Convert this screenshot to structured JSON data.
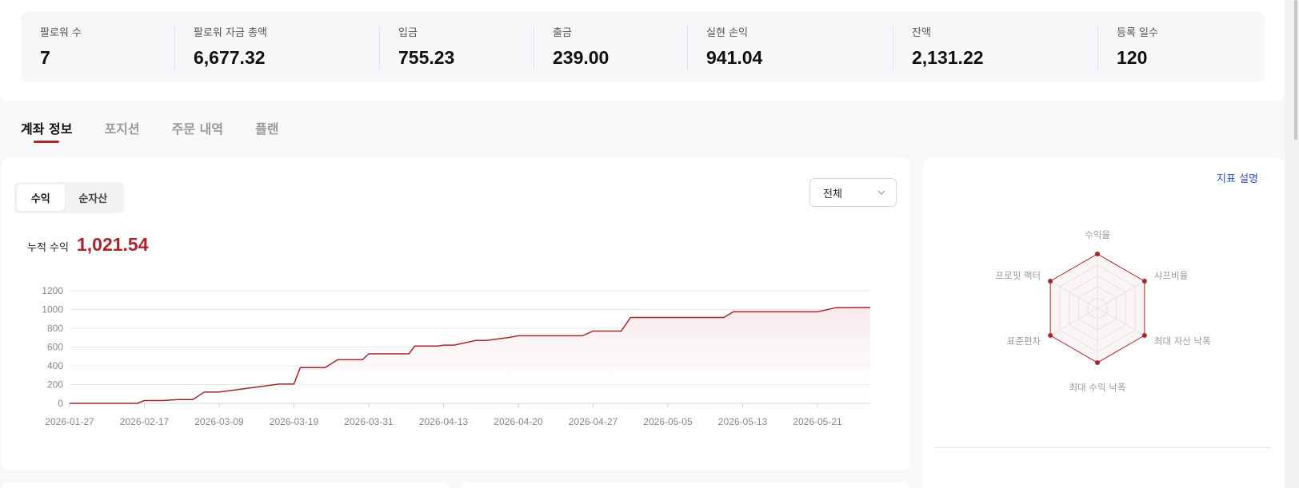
{
  "stats": [
    {
      "label": "팔로워 수",
      "value": "7"
    },
    {
      "label": "팔로워 자금 총액",
      "value": "6,677.32"
    },
    {
      "label": "입금",
      "value": "755.23"
    },
    {
      "label": "출금",
      "value": "239.00"
    },
    {
      "label": "실현 손익",
      "value": "941.04"
    },
    {
      "label": "잔액",
      "value": "2,131.22"
    },
    {
      "label": "등록 일수",
      "value": "120"
    }
  ],
  "tabs": [
    {
      "label": "계좌 정보",
      "active": true
    },
    {
      "label": "포지션",
      "active": false
    },
    {
      "label": "주문 내역",
      "active": false
    },
    {
      "label": "플랜",
      "active": false
    }
  ],
  "toggle": {
    "profit": "수익",
    "net_asset": "순자산"
  },
  "period_select": {
    "value": "전체"
  },
  "cumulative": {
    "label": "누적 수익",
    "value": "1,021.54"
  },
  "colors": {
    "accent": "#a8252f",
    "link": "#2f55c8",
    "fill": "#f7e9eb"
  },
  "chart_data": {
    "type": "area",
    "title": "",
    "xlabel": "",
    "ylabel": "",
    "ylim": [
      0,
      1200
    ],
    "yticks": [
      0,
      200,
      400,
      600,
      800,
      1000,
      1200
    ],
    "xtick_labels": [
      "2026-01-27",
      "2026-02-17",
      "2026-03-09",
      "2026-03-19",
      "2026-03-31",
      "2026-04-13",
      "2026-04-20",
      "2026-04-27",
      "2026-05-05",
      "2026-05-13",
      "2026-05-21"
    ],
    "grid": true,
    "series": [
      {
        "x": [
          "2026-01-27",
          "2026-02-15",
          "2026-02-17",
          "2026-02-22",
          "2026-02-26",
          "2026-03-02",
          "2026-03-05",
          "2026-03-09",
          "2026-03-17",
          "2026-03-19",
          "2026-03-20",
          "2026-03-24",
          "2026-03-26",
          "2026-03-30",
          "2026-03-31",
          "2026-04-07",
          "2026-04-08",
          "2026-04-12",
          "2026-04-13",
          "2026-04-14",
          "2026-04-16",
          "2026-04-17",
          "2026-04-19",
          "2026-04-20",
          "2026-04-26",
          "2026-04-27",
          "2026-04-30",
          "2026-05-01",
          "2026-05-05",
          "2026-05-11",
          "2026-05-12",
          "2026-05-21",
          "2026-05-23",
          "2026-06-04"
        ],
        "y": [
          0,
          0,
          30,
          30,
          40,
          40,
          120,
          120,
          205,
          205,
          380,
          380,
          465,
          465,
          528,
          528,
          610,
          610,
          620,
          620,
          670,
          670,
          700,
          720,
          720,
          770,
          770,
          915,
          915,
          915,
          975,
          975,
          1020,
          1021.54
        ]
      }
    ]
  },
  "radar": {
    "link": "지표 설명",
    "axes": [
      "수익율",
      "샤프비율",
      "최대 자산 낙폭",
      "최대 수익 낙폭",
      "표준편차",
      "프로핏 팩터"
    ],
    "values": [
      1,
      1,
      1,
      1,
      1,
      1
    ]
  }
}
